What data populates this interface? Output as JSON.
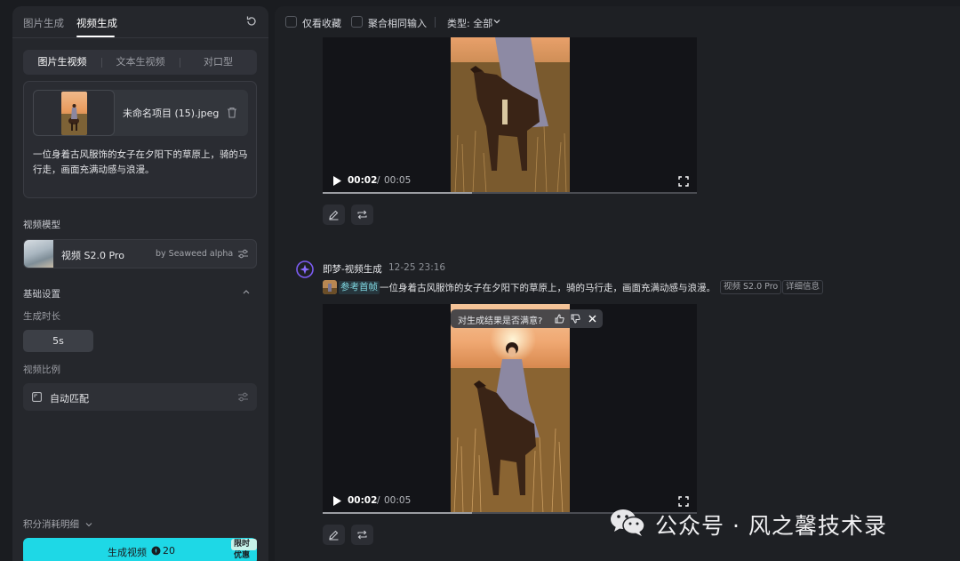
{
  "left_panel": {
    "top_tabs": [
      "图片生成",
      "视频生成"
    ],
    "active_top_tab": "视频生成",
    "mode_tabs": [
      "图片生视频",
      "文本生视频",
      "对口型"
    ],
    "active_mode_tab": "图片生视频",
    "upload": {
      "file_name": "未命名项目 (15).jpeg",
      "prompt": "一位身着古风服饰的女子在夕阳下的草原上，骑的马行走，画面充满动感与浪漫。"
    },
    "model_section_label": "视频模型",
    "model": {
      "name": "视频 S2.0 Pro",
      "by": "by Seaweed alpha"
    },
    "basic_settings_label": "基础设置",
    "duration_label": "生成时长",
    "duration_value": "5s",
    "ratio_label": "视频比例",
    "ratio_value": "自动匹配",
    "credits_label": "积分消耗明细",
    "generate": {
      "label": "生成视频",
      "cost": "20",
      "promo": "限时优惠"
    }
  },
  "right_panel": {
    "toolbar": {
      "favorites_only": "仅看收藏",
      "merge_same_input": "聚合相同输入",
      "type_filter": "类型: 全部"
    },
    "video1": {
      "current": "00:02",
      "sep": "/",
      "total": "00:05",
      "progress": 0.4
    },
    "entry": {
      "agent_name": "即梦-视频生成",
      "time": "12-25  23:16",
      "ref_label": "参考首帧",
      "prompt": "一位身着古风服饰的女子在夕阳下的草原上，骑的马行走，画面充满动感与浪漫。",
      "tags": [
        "视频 S2.0 Pro",
        "详细信息"
      ]
    },
    "feedback_prompt": "对生成结果是否满意?",
    "video2": {
      "current": "00:02",
      "sep": "/",
      "total": "00:05",
      "progress": 0.4
    }
  },
  "watermark": {
    "text": "公众号 · 风之馨技术录"
  },
  "colors": {
    "accent": "#1ed8e6",
    "panel": "#25272c",
    "bg": "#1a1c20"
  }
}
